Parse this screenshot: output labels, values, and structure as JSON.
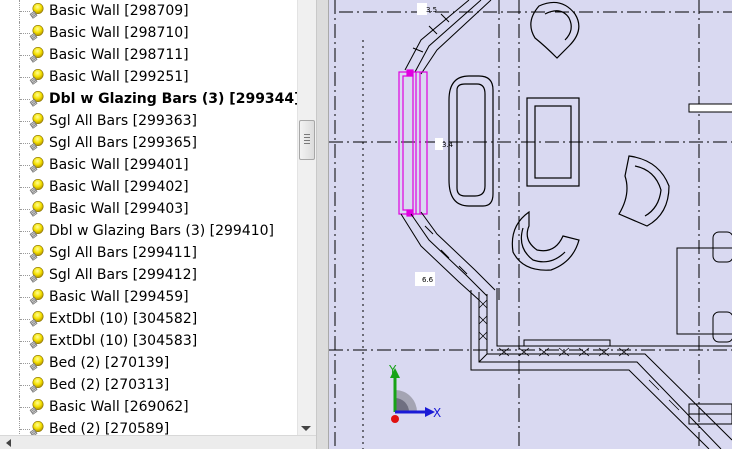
{
  "tree": {
    "items": [
      {
        "label": "Basic Wall [298709]",
        "selected": false
      },
      {
        "label": "Basic Wall [298710]",
        "selected": false
      },
      {
        "label": "Basic Wall [298711]",
        "selected": false
      },
      {
        "label": "Basic Wall [299251]",
        "selected": false
      },
      {
        "label": "Dbl w Glazing Bars (3) [299344]",
        "selected": true
      },
      {
        "label": "Sgl All Bars [299363]",
        "selected": false
      },
      {
        "label": "Sgl All Bars [299365]",
        "selected": false
      },
      {
        "label": "Basic Wall [299401]",
        "selected": false
      },
      {
        "label": "Basic Wall [299402]",
        "selected": false
      },
      {
        "label": "Basic Wall [299403]",
        "selected": false
      },
      {
        "label": "Dbl w Glazing Bars (3) [299410]",
        "selected": false
      },
      {
        "label": "Sgl All Bars [299411]",
        "selected": false
      },
      {
        "label": "Sgl All Bars [299412]",
        "selected": false
      },
      {
        "label": "Basic Wall [299459]",
        "selected": false
      },
      {
        "label": "ExtDbl (10) [304582]",
        "selected": false
      },
      {
        "label": "ExtDbl (10) [304583]",
        "selected": false
      },
      {
        "label": "Bed (2) [270139]",
        "selected": false
      },
      {
        "label": "Bed (2) [270313]",
        "selected": false
      },
      {
        "label": "Basic Wall [269062]",
        "selected": false
      },
      {
        "label": "Bed (2) [270589]",
        "selected": false
      }
    ],
    "item_icon": "lightbulb-icon"
  },
  "viewport": {
    "background": "#d9d9f1",
    "dimension_labels": [
      "3.5",
      "3.4",
      "6.6"
    ],
    "axes": {
      "x_label": "X",
      "y_label": "Y",
      "x_color": "#1a1ad6",
      "y_color": "#17a317",
      "origin_color": "#e01010"
    },
    "selection_color": "#e000e0"
  }
}
